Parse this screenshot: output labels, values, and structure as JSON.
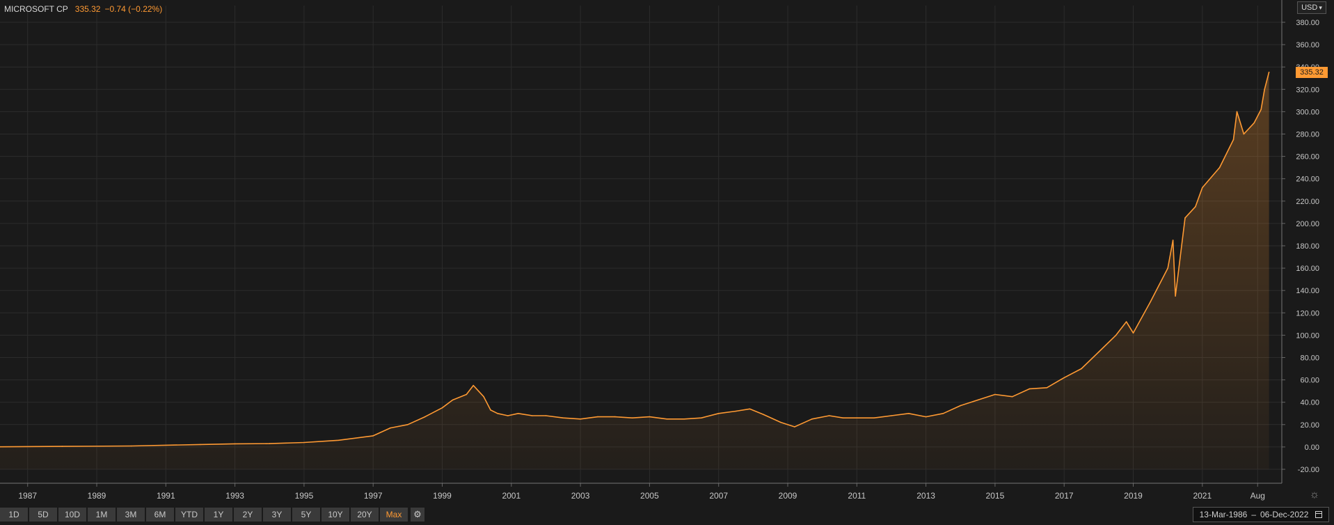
{
  "header": {
    "symbol": "MICROSOFT CP",
    "price": "335.32",
    "change": "−0.74 (−0.22%)"
  },
  "currency": {
    "value": "USD",
    "chevron": "▾"
  },
  "last_price_tag": "335.32",
  "toolbar": {
    "ranges": [
      "1D",
      "5D",
      "10D",
      "1M",
      "3M",
      "6M",
      "YTD",
      "1Y",
      "2Y",
      "3Y",
      "5Y",
      "10Y",
      "20Y",
      "Max"
    ],
    "active": "Max",
    "settings_icon": "gear-icon"
  },
  "date_range": {
    "start": "13-Mar-1986",
    "separator": "–",
    "end": "06-Dec-2022",
    "icon": "calendar-icon"
  },
  "crosshair_icon": "crosshair-icon",
  "colors": {
    "background": "#1a1a1a",
    "grid": "#2c2c2c",
    "line": "#ff9a33",
    "axis_text": "#c8c8c8"
  },
  "chart_data": {
    "type": "area",
    "y_axis": {
      "side": "right",
      "ylim": [
        -20,
        380
      ],
      "ticks": [
        -20,
        0,
        20,
        40,
        60,
        80,
        100,
        120,
        140,
        160,
        180,
        200,
        220,
        240,
        260,
        280,
        300,
        320,
        340,
        360,
        380
      ],
      "tick_labels": [
        "-20.00",
        "0.00",
        "20.00",
        "40.00",
        "60.00",
        "80.00",
        "100.00",
        "120.00",
        "140.00",
        "160.00",
        "180.00",
        "200.00",
        "220.00",
        "240.00",
        "260.00",
        "280.00",
        "300.00",
        "320.00",
        "340.00",
        "360.00",
        "380.00"
      ]
    },
    "x_axis": {
      "range": [
        1986.2,
        2023.3
      ],
      "ticks": [
        1987,
        1989,
        1991,
        1993,
        1995,
        1997,
        1999,
        2001,
        2003,
        2005,
        2007,
        2009,
        2011,
        2013,
        2015,
        2017,
        2019,
        2021,
        2022.6
      ],
      "tick_labels": [
        "1987",
        "1989",
        "1991",
        "1993",
        "1995",
        "1997",
        "1999",
        "2001",
        "2003",
        "2005",
        "2007",
        "2009",
        "2011",
        "2013",
        "2015",
        "2017",
        "2019",
        "2021",
        "Aug"
      ]
    },
    "grid": true,
    "last_value": 335.32,
    "series": [
      {
        "x": [
          1986.2,
          1988.0,
          1990.0,
          1992.0,
          1993.0,
          1994.0,
          1995.0,
          1996.0,
          1997.0,
          1997.5,
          1998.0,
          1998.5,
          1999.0,
          1999.3,
          1999.7,
          1999.9,
          2000.2,
          2000.4,
          2000.6,
          2000.9,
          2001.2,
          2001.6,
          2002.0,
          2002.5,
          2003.0,
          2003.5,
          2004.0,
          2004.5,
          2005.0,
          2005.5,
          2006.0,
          2006.5,
          2007.0,
          2007.5,
          2007.9,
          2008.3,
          2008.8,
          2009.2,
          2009.7,
          2010.2,
          2010.6,
          2011.0,
          2011.5,
          2012.0,
          2012.5,
          2013.0,
          2013.5,
          2014.0,
          2014.5,
          2015.0,
          2015.5,
          2016.0,
          2016.5,
          2017.0,
          2017.5,
          2018.0,
          2018.5,
          2018.8,
          2019.0,
          2019.5,
          2020.0,
          2020.15,
          2020.22,
          2020.5,
          2020.8,
          2021.0,
          2021.5,
          2021.9,
          2022.0,
          2022.2,
          2022.5,
          2022.7,
          2022.8,
          2022.93
        ],
        "y": [
          0.1,
          0.5,
          0.9,
          2.2,
          2.8,
          3,
          4,
          6,
          10,
          17,
          20,
          27,
          35,
          42,
          47,
          55,
          45,
          33,
          30,
          28,
          30,
          28,
          28,
          26,
          25,
          27,
          27,
          26,
          27,
          25,
          25,
          26,
          30,
          32,
          34,
          29,
          22,
          18,
          25,
          28,
          26,
          26,
          26,
          28,
          30,
          27,
          30,
          37,
          42,
          47,
          45,
          52,
          53,
          62,
          70,
          85,
          100,
          112,
          102,
          130,
          160,
          185,
          135,
          205,
          215,
          232,
          250,
          275,
          300,
          280,
          290,
          302,
          320,
          335.32
        ]
      }
    ]
  }
}
